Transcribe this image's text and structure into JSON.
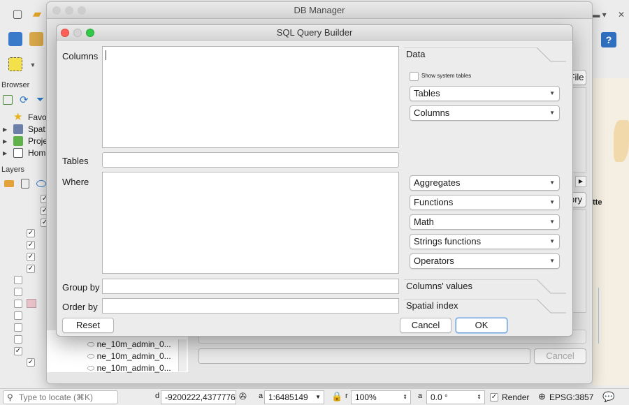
{
  "db_manager": {
    "title": "DB Manager",
    "side_buttons": {
      "file_label": "File",
      "history_label": "ory"
    },
    "bottom_cancel_label": "Cancel",
    "layer_list": [
      "ne_10m_admin_0...",
      "ne_10m_admin_0...",
      "ne_10m_admin_0..."
    ]
  },
  "qgis": {
    "browser_title": "Browser",
    "layers_title": "Layers",
    "browser_items": [
      {
        "label": "Favo",
        "icon": "star-icon"
      },
      {
        "label": "Spat",
        "icon": "spatial-icon"
      },
      {
        "label": "Proje",
        "icon": "project-icon"
      },
      {
        "label": "Hom",
        "icon": "home-icon"
      }
    ],
    "map_label": "tte"
  },
  "dialog": {
    "title": "SQL Query Builder",
    "columns_label": "Columns",
    "tables_label": "Tables",
    "where_label": "Where",
    "group_by_label": "Group by",
    "order_by_label": "Order by",
    "columns_value": "",
    "tables_value": "",
    "where_value": "",
    "group_by_value": "",
    "order_by_value": "",
    "data_tab": "Data",
    "show_system_tables": "Show system tables",
    "combo_tables": "Tables",
    "combo_columns": "Columns",
    "combo_aggregates": "Aggregates",
    "combo_functions": "Functions",
    "combo_math": "Math",
    "combo_strings": "Strings functions",
    "combo_operators": "Operators",
    "columns_values_tab": "Columns' values",
    "spatial_index_tab": "Spatial index",
    "reset_label": "Reset",
    "cancel_label": "Cancel",
    "ok_label": "OK"
  },
  "statusbar": {
    "locate_placeholder": "Type to locate (⌘K)",
    "coordinate": "-9200222,4377776",
    "scale": "1:6485149",
    "magnifier": "100%",
    "rotation": "0.0 °",
    "render_label": "Render",
    "crs": "EPSG:3857"
  },
  "colors": {
    "close": "#fc5f57",
    "minimize": "#fdbc2e",
    "zoom": "#34c84a",
    "default_button": "#6e9fd8"
  }
}
